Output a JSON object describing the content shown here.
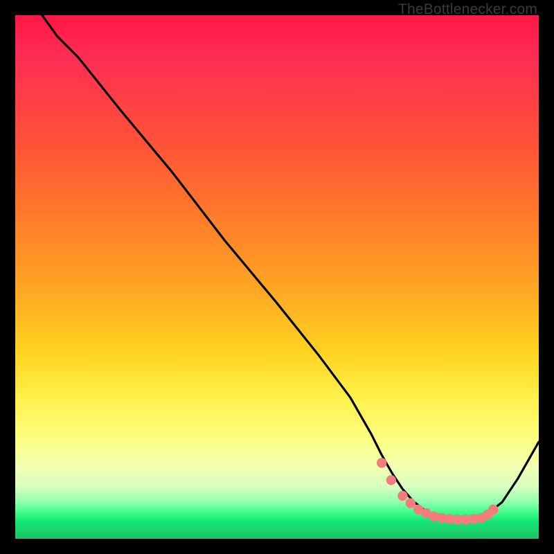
{
  "watermark": "TheBottlenecker.com",
  "colors": {
    "curve_stroke": "#000000",
    "marker_fill": "#f47c7c",
    "marker_stroke": "#d85a5a",
    "background": "#000000"
  },
  "chart_data": {
    "type": "line",
    "title": "",
    "xlabel": "",
    "ylabel": "",
    "xlim": [
      0,
      100
    ],
    "ylim": [
      0,
      100
    ],
    "grid": false,
    "x": [
      3,
      8,
      12,
      20,
      30,
      40,
      50,
      58,
      64,
      68,
      70,
      72,
      74,
      76,
      78,
      80,
      82,
      84,
      86,
      88,
      90,
      93,
      96,
      100
    ],
    "y": [
      103,
      96,
      92,
      82,
      70,
      57,
      45,
      35,
      27,
      20,
      16,
      12.5,
      9.5,
      7.2,
      5.6,
      4.5,
      3.9,
      3.6,
      3.6,
      3.9,
      4.6,
      7.0,
      11.5,
      18.5
    ],
    "markers": {
      "note": "flat-bottom valley markers",
      "x": [
        70.0,
        71.8,
        74.0,
        75.5,
        77.0,
        78.5,
        80.0,
        81.5,
        83.0,
        84.5,
        86.0,
        87.5,
        89.0,
        90.2,
        91.3
      ],
      "y": [
        14.5,
        11.2,
        8.2,
        6.8,
        5.6,
        4.9,
        4.3,
        4.0,
        3.8,
        3.7,
        3.7,
        3.8,
        4.0,
        4.6,
        5.6
      ]
    }
  }
}
